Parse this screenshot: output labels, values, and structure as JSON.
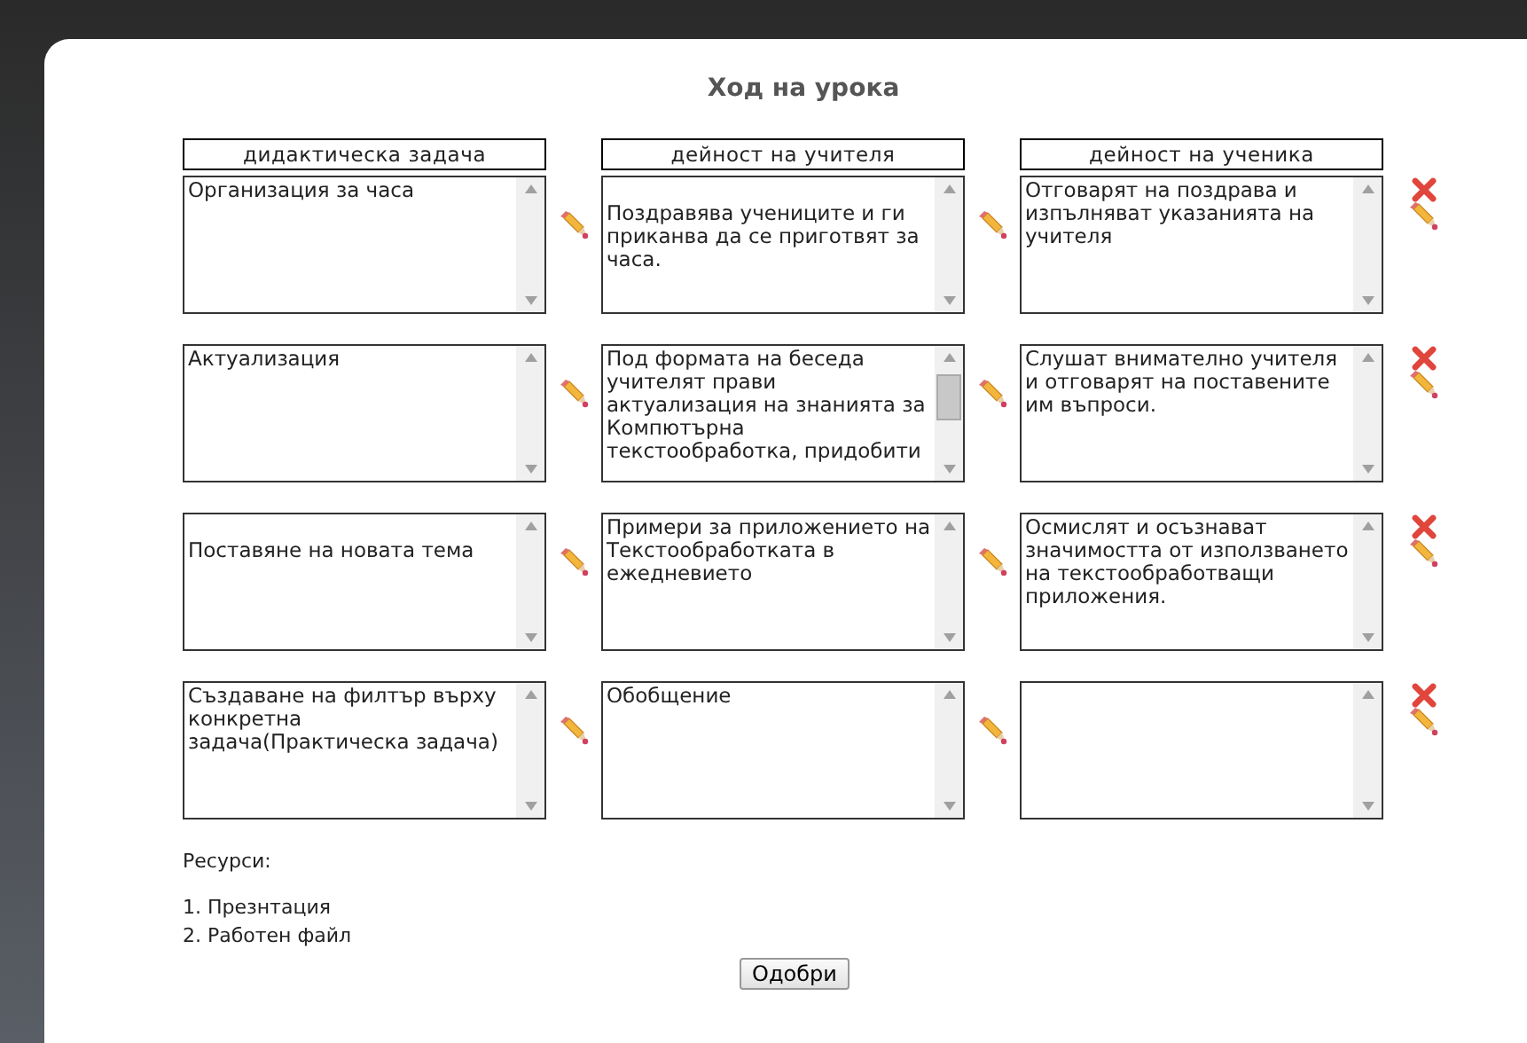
{
  "title": "Ход на урока",
  "columns": [
    "дидактическа задача",
    "дейност на учителя",
    "дейност на ученика"
  ],
  "rows": [
    {
      "cells": [
        "Организация за часа",
        "\nПоздравява учениците и ги приканва да се приготвят за часа.",
        "Отговарят на поздрава и изпълняват указанията на учителя"
      ],
      "scrolled": [
        false,
        false,
        false
      ]
    },
    {
      "cells": [
        "Актуализация",
        "Под формата на беседа учителят прави актуализация на знанията за Компютърна текстообработка, придобити",
        "Слушат внимателно учителя и отговарят на поставените им въпроси."
      ],
      "scrolled": [
        false,
        true,
        false
      ]
    },
    {
      "cells": [
        "\nПоставяне на новата тема",
        "Примери за приложението на Текстообработката в ежедневието",
        "Осмислят и осъзнават значимостта от използването на текстообработващи приложения."
      ],
      "scrolled": [
        false,
        false,
        false
      ]
    },
    {
      "cells": [
        "Създаване на филтър върху конкретна задача(Практическа задача)",
        "Обобщение",
        ""
      ],
      "scrolled": [
        false,
        false,
        false
      ]
    }
  ],
  "resources_label": "Ресурси:",
  "resources": [
    "1. Презнтация",
    "2. Работен файл"
  ],
  "approve_button": "Одобри"
}
